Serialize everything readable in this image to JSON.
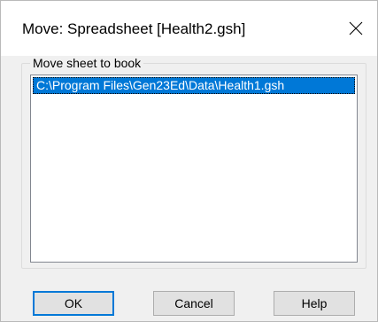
{
  "window": {
    "title": "Move: Spreadsheet [Health2.gsh]",
    "close_icon": "close-icon"
  },
  "group": {
    "label": "Move sheet to book",
    "items": [
      {
        "label": "C:\\Program Files\\Gen23Ed\\Data\\Health1.gsh",
        "selected": true
      }
    ]
  },
  "buttons": {
    "ok": "OK",
    "cancel": "Cancel",
    "help": "Help"
  },
  "colors": {
    "selection": "#0078d7",
    "dialog_bg": "#f0f0f0",
    "button_bg": "#e1e1e1"
  }
}
